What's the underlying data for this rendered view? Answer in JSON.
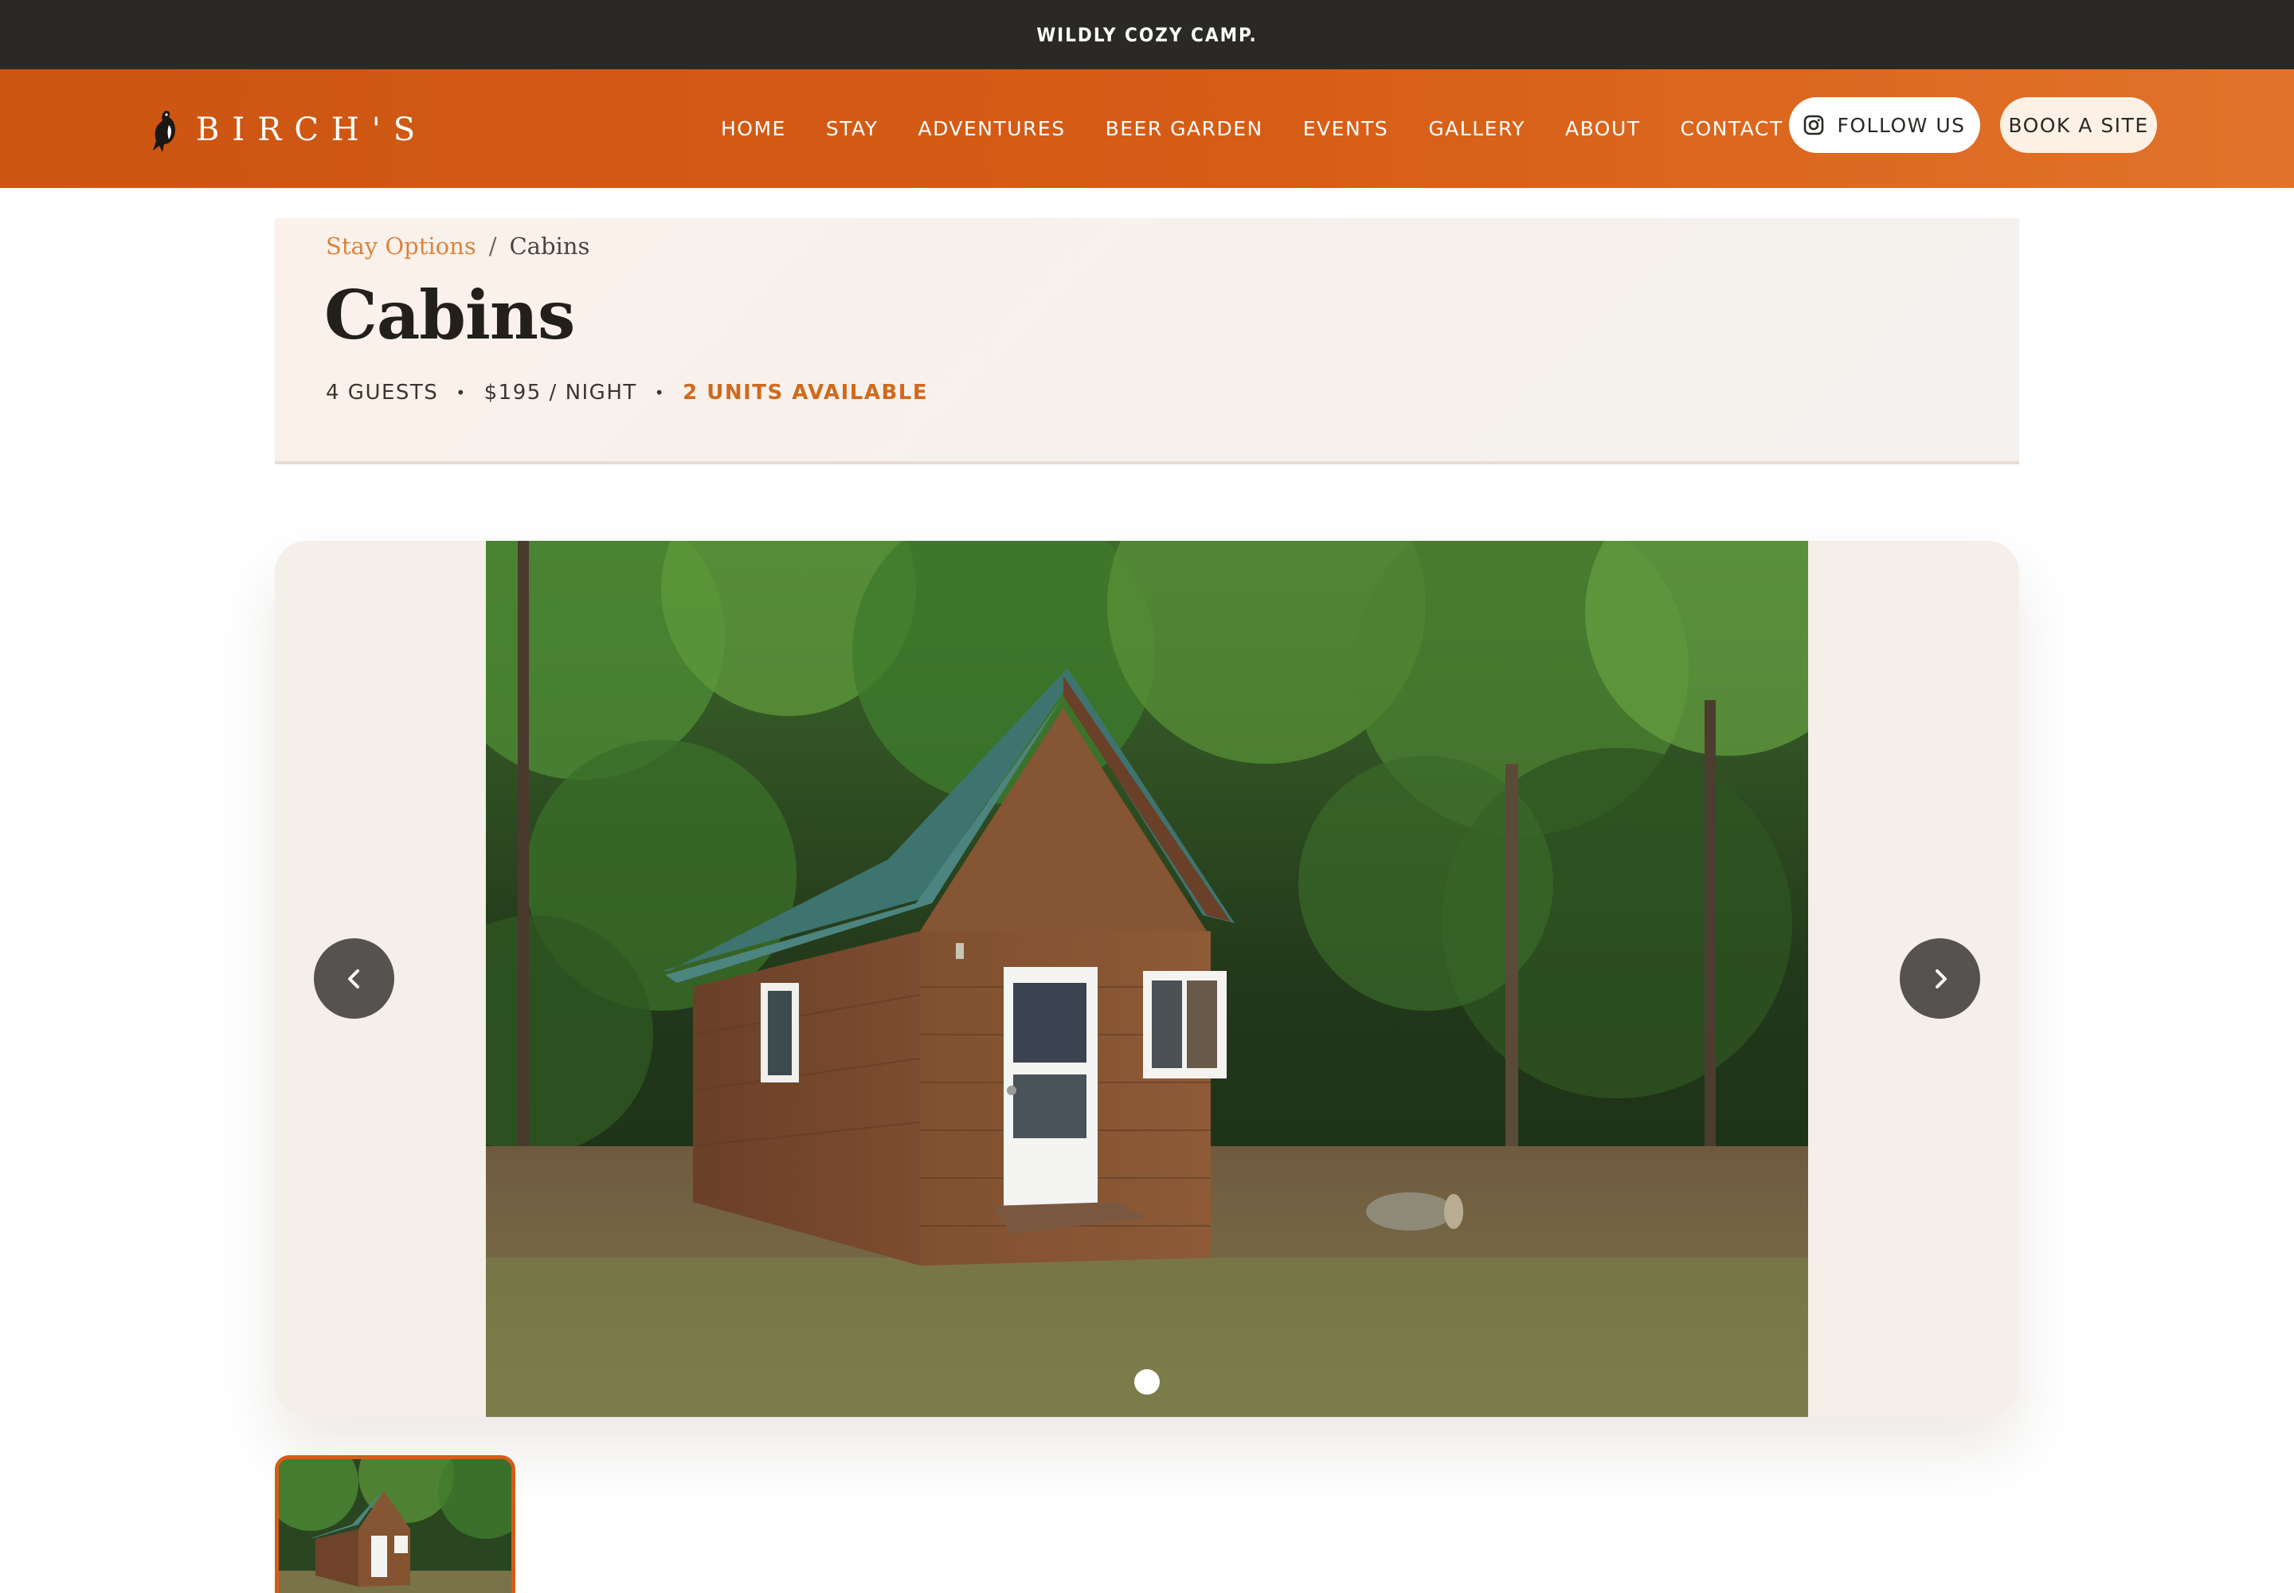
{
  "topbar": {
    "tagline": "WILDLY COZY CAMP."
  },
  "header": {
    "logo_text": "BIRCH'S",
    "nav": [
      "HOME",
      "STAY",
      "ADVENTURES",
      "BEER GARDEN",
      "EVENTS",
      "GALLERY",
      "ABOUT",
      "CONTACT"
    ],
    "follow_label": "FOLLOW US",
    "book_label": "BOOK A SITE",
    "brand_color": "#d65d16"
  },
  "breadcrumb": {
    "parent": "Stay Options",
    "separator": "/",
    "current": "Cabins"
  },
  "page": {
    "title": "Cabins",
    "guests": "4 GUESTS",
    "price": "$195 / NIGHT",
    "availability": "2 UNITS AVAILABLE",
    "meta_separator": "•"
  },
  "gallery": {
    "image_alt": "Wooden cabin with green metal roof in the forest",
    "slide_count": 1,
    "active_slide": 1,
    "prev_icon": "chevron-left-icon",
    "next_icon": "chevron-right-icon"
  },
  "thumbnails": [
    {
      "alt": "Wooden cabin with green metal roof in the forest",
      "active": true
    }
  ]
}
